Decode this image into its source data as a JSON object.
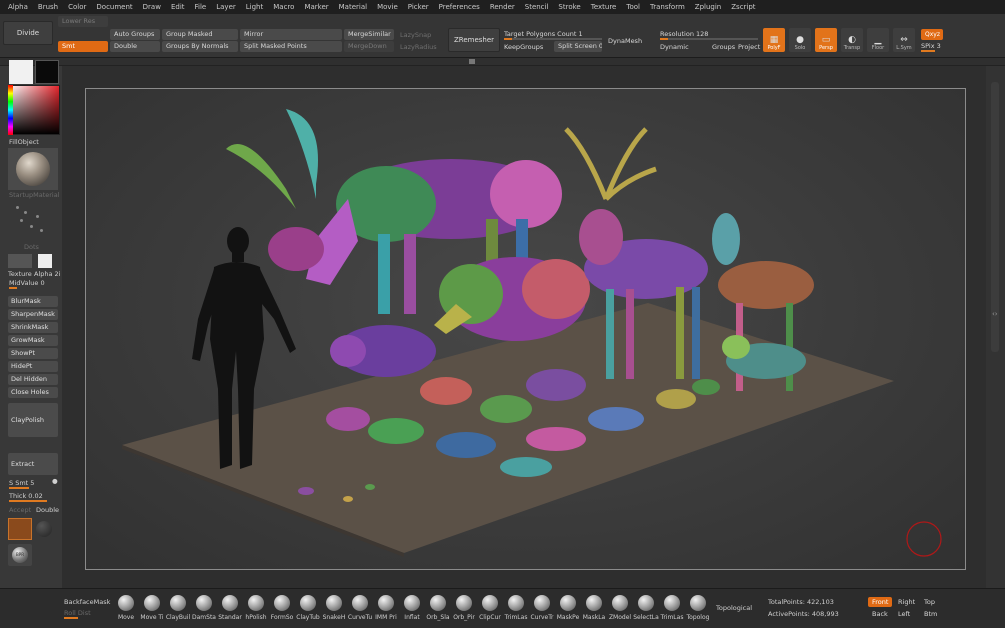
{
  "menu": [
    "Alpha",
    "Brush",
    "Color",
    "Document",
    "Draw",
    "Edit",
    "File",
    "Layer",
    "Light",
    "Macro",
    "Marker",
    "Material",
    "Movie",
    "Picker",
    "Preferences",
    "Render",
    "Stencil",
    "Stroke",
    "Texture",
    "Tool",
    "Transform",
    "Zplugin",
    "Zscript"
  ],
  "shelf": {
    "divide": "Divide",
    "lower_res": "Lower Res",
    "smt": "Smt",
    "auto_groups": "Auto Groups",
    "double": "Double",
    "group_masked": "Group Masked",
    "groups_by_normals": "Groups By Normals",
    "mirror": "Mirror",
    "split_masked_points": "Split Masked Points",
    "merge_similar": "MergeSimilar",
    "merge_down": "MergeDown",
    "lazy_snap": "LazySnap",
    "lazy_radius": "LazyRadius",
    "zremesher": "ZRemesher",
    "target_polygons": "Target Polygons Count 1",
    "keep_groups": "KeepGroups",
    "split_screen": "Split Screen 0",
    "dynamesh": "DynaMesh",
    "resolution": "Resolution 128",
    "dynamic": "Dynamic",
    "groups": "Groups",
    "project": "Project",
    "polyf": "PolyF",
    "solo": "Solo",
    "persp": "Persp",
    "transp": "Transp",
    "floor": "Floor",
    "lsym": "L.Sym",
    "qxyz": "Qxyz",
    "spix": "SPix 3"
  },
  "left": {
    "fill_object": "FillObject",
    "material": "StartupMaterial",
    "dots": "Dots",
    "texture": "Texture",
    "alpha": "Alpha 2i",
    "mid_value": "MidValue 0",
    "blur_mask": "BlurMask",
    "sharpen_mask": "SharpenMask",
    "shrink_mask": "ShrinkMask",
    "grow_mask": "GrowMask",
    "show_pt": "ShowPt",
    "hide_pt": "HidePt",
    "del_hidden": "Del Hidden",
    "close_holes": "Close Holes",
    "clay_polish": "ClayPolish",
    "extract": "Extract",
    "s_smt": "S Smt 5",
    "thick": "Thick 0.02",
    "accept": "Accept",
    "double": "Double",
    "bpr": "BPR"
  },
  "bottom": {
    "backface_mask": "BackfaceMask",
    "roll_dist": "Roll Dist",
    "brushes": [
      "Move",
      "Move Ti",
      "ClayBuil",
      "DamSta",
      "Standar",
      "hPolish",
      "FormSo",
      "ClayTub",
      "SnakeH",
      "CurveTu",
      "IMM Pri",
      "Inflat",
      "Orb_Sla",
      "Orb_Pir",
      "ClipCur",
      "TrimLas",
      "CurveTr",
      "MaskPe",
      "MaskLa",
      "ZModel",
      "SelectLa",
      "TrimLas",
      "Topolog"
    ],
    "topological": "Topological",
    "total_points": "TotalPoints: 422,103",
    "active_points": "ActivePoints: 408,993",
    "front": "Front",
    "right": "Right",
    "top": "Top",
    "back": "Back",
    "left": "Left",
    "btm": "Btm"
  },
  "colors": {
    "accent": "#e06a14",
    "ui_dark": "#2b2b2b",
    "panel": "#383838"
  }
}
